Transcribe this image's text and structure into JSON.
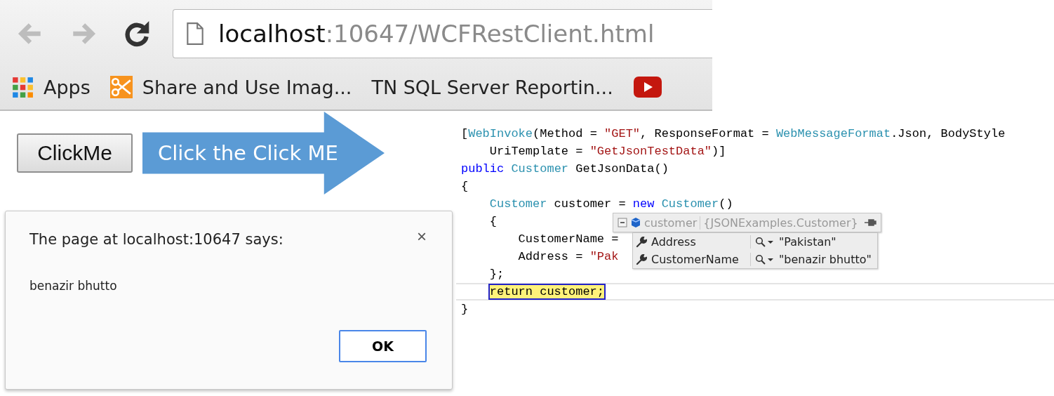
{
  "browser": {
    "nav_buttons": [
      {
        "kind": "back",
        "disabled": true
      },
      {
        "kind": "forward",
        "disabled": true
      },
      {
        "kind": "reload",
        "disabled": false
      }
    ],
    "address": {
      "host": "localhost",
      "path": ":10647/WCFRestClient.html"
    },
    "bookmarks": [
      {
        "kind": "apps",
        "label": "Apps"
      },
      {
        "kind": "scissors",
        "label": "Share and Use Imag..."
      },
      {
        "kind": "text",
        "label": "TN  SQL Server Reportin..."
      },
      {
        "kind": "play"
      }
    ]
  },
  "page": {
    "button": "ClickMe",
    "callout": "Click the Click ME",
    "dialog": {
      "title": "The page at localhost:10647 says:",
      "close": "×",
      "message": "benazir bhutto",
      "ok": "OK"
    }
  },
  "code": {
    "lines": [
      {
        "current": false,
        "tokens": [
          {
            "kind": "plain",
            "text": "["
          },
          {
            "kind": "type",
            "text": "WebInvoke"
          },
          {
            "kind": "plain",
            "text": "(Method = "
          },
          {
            "kind": "string",
            "text": "\"GET\""
          },
          {
            "kind": "plain",
            "text": ", ResponseFormat = "
          },
          {
            "kind": "type",
            "text": "WebMessageFormat"
          },
          {
            "kind": "plain",
            "text": ".Json, BodyStyle"
          }
        ]
      },
      {
        "current": false,
        "tokens": [
          {
            "kind": "plain",
            "text": "    UriTemplate = "
          },
          {
            "kind": "string",
            "text": "\"GetJsonTestData\""
          },
          {
            "kind": "plain",
            "text": ")]"
          }
        ]
      },
      {
        "current": false,
        "tokens": [
          {
            "kind": "keyword",
            "text": "public"
          },
          {
            "kind": "type",
            "text": " Customer"
          },
          {
            "kind": "plain",
            "text": " GetJsonData()"
          }
        ]
      },
      {
        "current": false,
        "tokens": [
          {
            "kind": "plain",
            "text": "{"
          }
        ]
      },
      {
        "current": false,
        "tokens": [
          {
            "kind": "type",
            "text": "    Customer"
          },
          {
            "kind": "plain",
            "text": " customer = "
          },
          {
            "kind": "keyword",
            "text": "new"
          },
          {
            "kind": "type",
            "text": " Customer"
          },
          {
            "kind": "plain",
            "text": "()"
          }
        ]
      },
      {
        "current": false,
        "tokens": [
          {
            "kind": "plain",
            "text": "    {"
          }
        ]
      },
      {
        "current": false,
        "tokens": [
          {
            "kind": "plain",
            "text": "        CustomerName ="
          }
        ]
      },
      {
        "current": false,
        "tokens": [
          {
            "kind": "plain",
            "text": "        Address = "
          },
          {
            "kind": "string",
            "text": "\"Pak"
          }
        ]
      },
      {
        "current": false,
        "tokens": [
          {
            "kind": "plain",
            "text": "    };"
          }
        ]
      },
      {
        "current": true,
        "tokens": [
          {
            "kind": "plain",
            "text": "return customer;"
          }
        ]
      },
      {
        "current": false,
        "tokens": [
          {
            "kind": "plain",
            "text": "}"
          }
        ]
      }
    ],
    "datatip": {
      "name": "customer",
      "type": "{JSONExamples.Customer}",
      "expanded": true,
      "rows": [
        {
          "name": "Address",
          "value": "\"Pakistan\""
        },
        {
          "name": "CustomerName",
          "value": "\"benazir bhutto\""
        }
      ]
    }
  }
}
